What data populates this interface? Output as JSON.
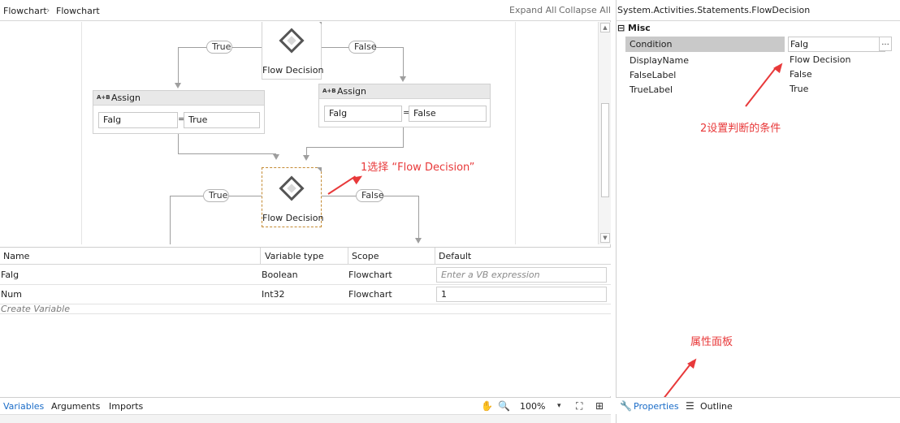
{
  "breadcrumb": {
    "root": "Flowchart",
    "separator": "›",
    "current": "Flowchart"
  },
  "toolbar": {
    "expand_all": "Expand All",
    "collapse_all": "Collapse All"
  },
  "canvas": {
    "top_decision": {
      "label": "Flow Decision",
      "true_label": "True",
      "false_label": "False"
    },
    "assign_left": {
      "title": "Assign",
      "icon_text": "A+B",
      "to": "Falg",
      "value": "True"
    },
    "assign_right": {
      "title": "Assign",
      "icon_text": "A+B",
      "to": "Falg",
      "value": "False"
    },
    "bottom_decision": {
      "label": "Flow Decision",
      "true_label": "True",
      "false_label": "False"
    },
    "equals": "="
  },
  "annotations": {
    "select_decision": "1选择 “Flow Decision”",
    "set_condition": "2设置判断的条件",
    "properties_panel": "属性面板",
    "color": "#e8393a"
  },
  "variables": {
    "headers": {
      "name": "Name",
      "type": "Variable type",
      "scope": "Scope",
      "default": "Default"
    },
    "rows": [
      {
        "name": "Falg",
        "type": "Boolean",
        "scope": "Flowchart",
        "default": "Enter a VB expression",
        "placeholder": true
      },
      {
        "name": "Num",
        "type": "Int32",
        "scope": "Flowchart",
        "default": "1",
        "placeholder": false
      }
    ],
    "create_label": "Create Variable"
  },
  "bottom_bar": {
    "tabs": [
      "Variables",
      "Arguments",
      "Imports"
    ],
    "zoom": "100%",
    "icons": [
      "hand-icon",
      "zoom-icon",
      "fit-screen-icon",
      "overview-icon"
    ]
  },
  "properties": {
    "title": "System.Activities.Statements.FlowDecision",
    "category": "Misc",
    "rows": [
      {
        "name": "Condition",
        "value": "Falg"
      },
      {
        "name": "DisplayName",
        "value": "Flow Decision"
      },
      {
        "name": "FalseLabel",
        "value": "False"
      },
      {
        "name": "TrueLabel",
        "value": "True"
      }
    ],
    "ellipsis": "...",
    "tabs": [
      "Properties",
      "Outline"
    ]
  }
}
